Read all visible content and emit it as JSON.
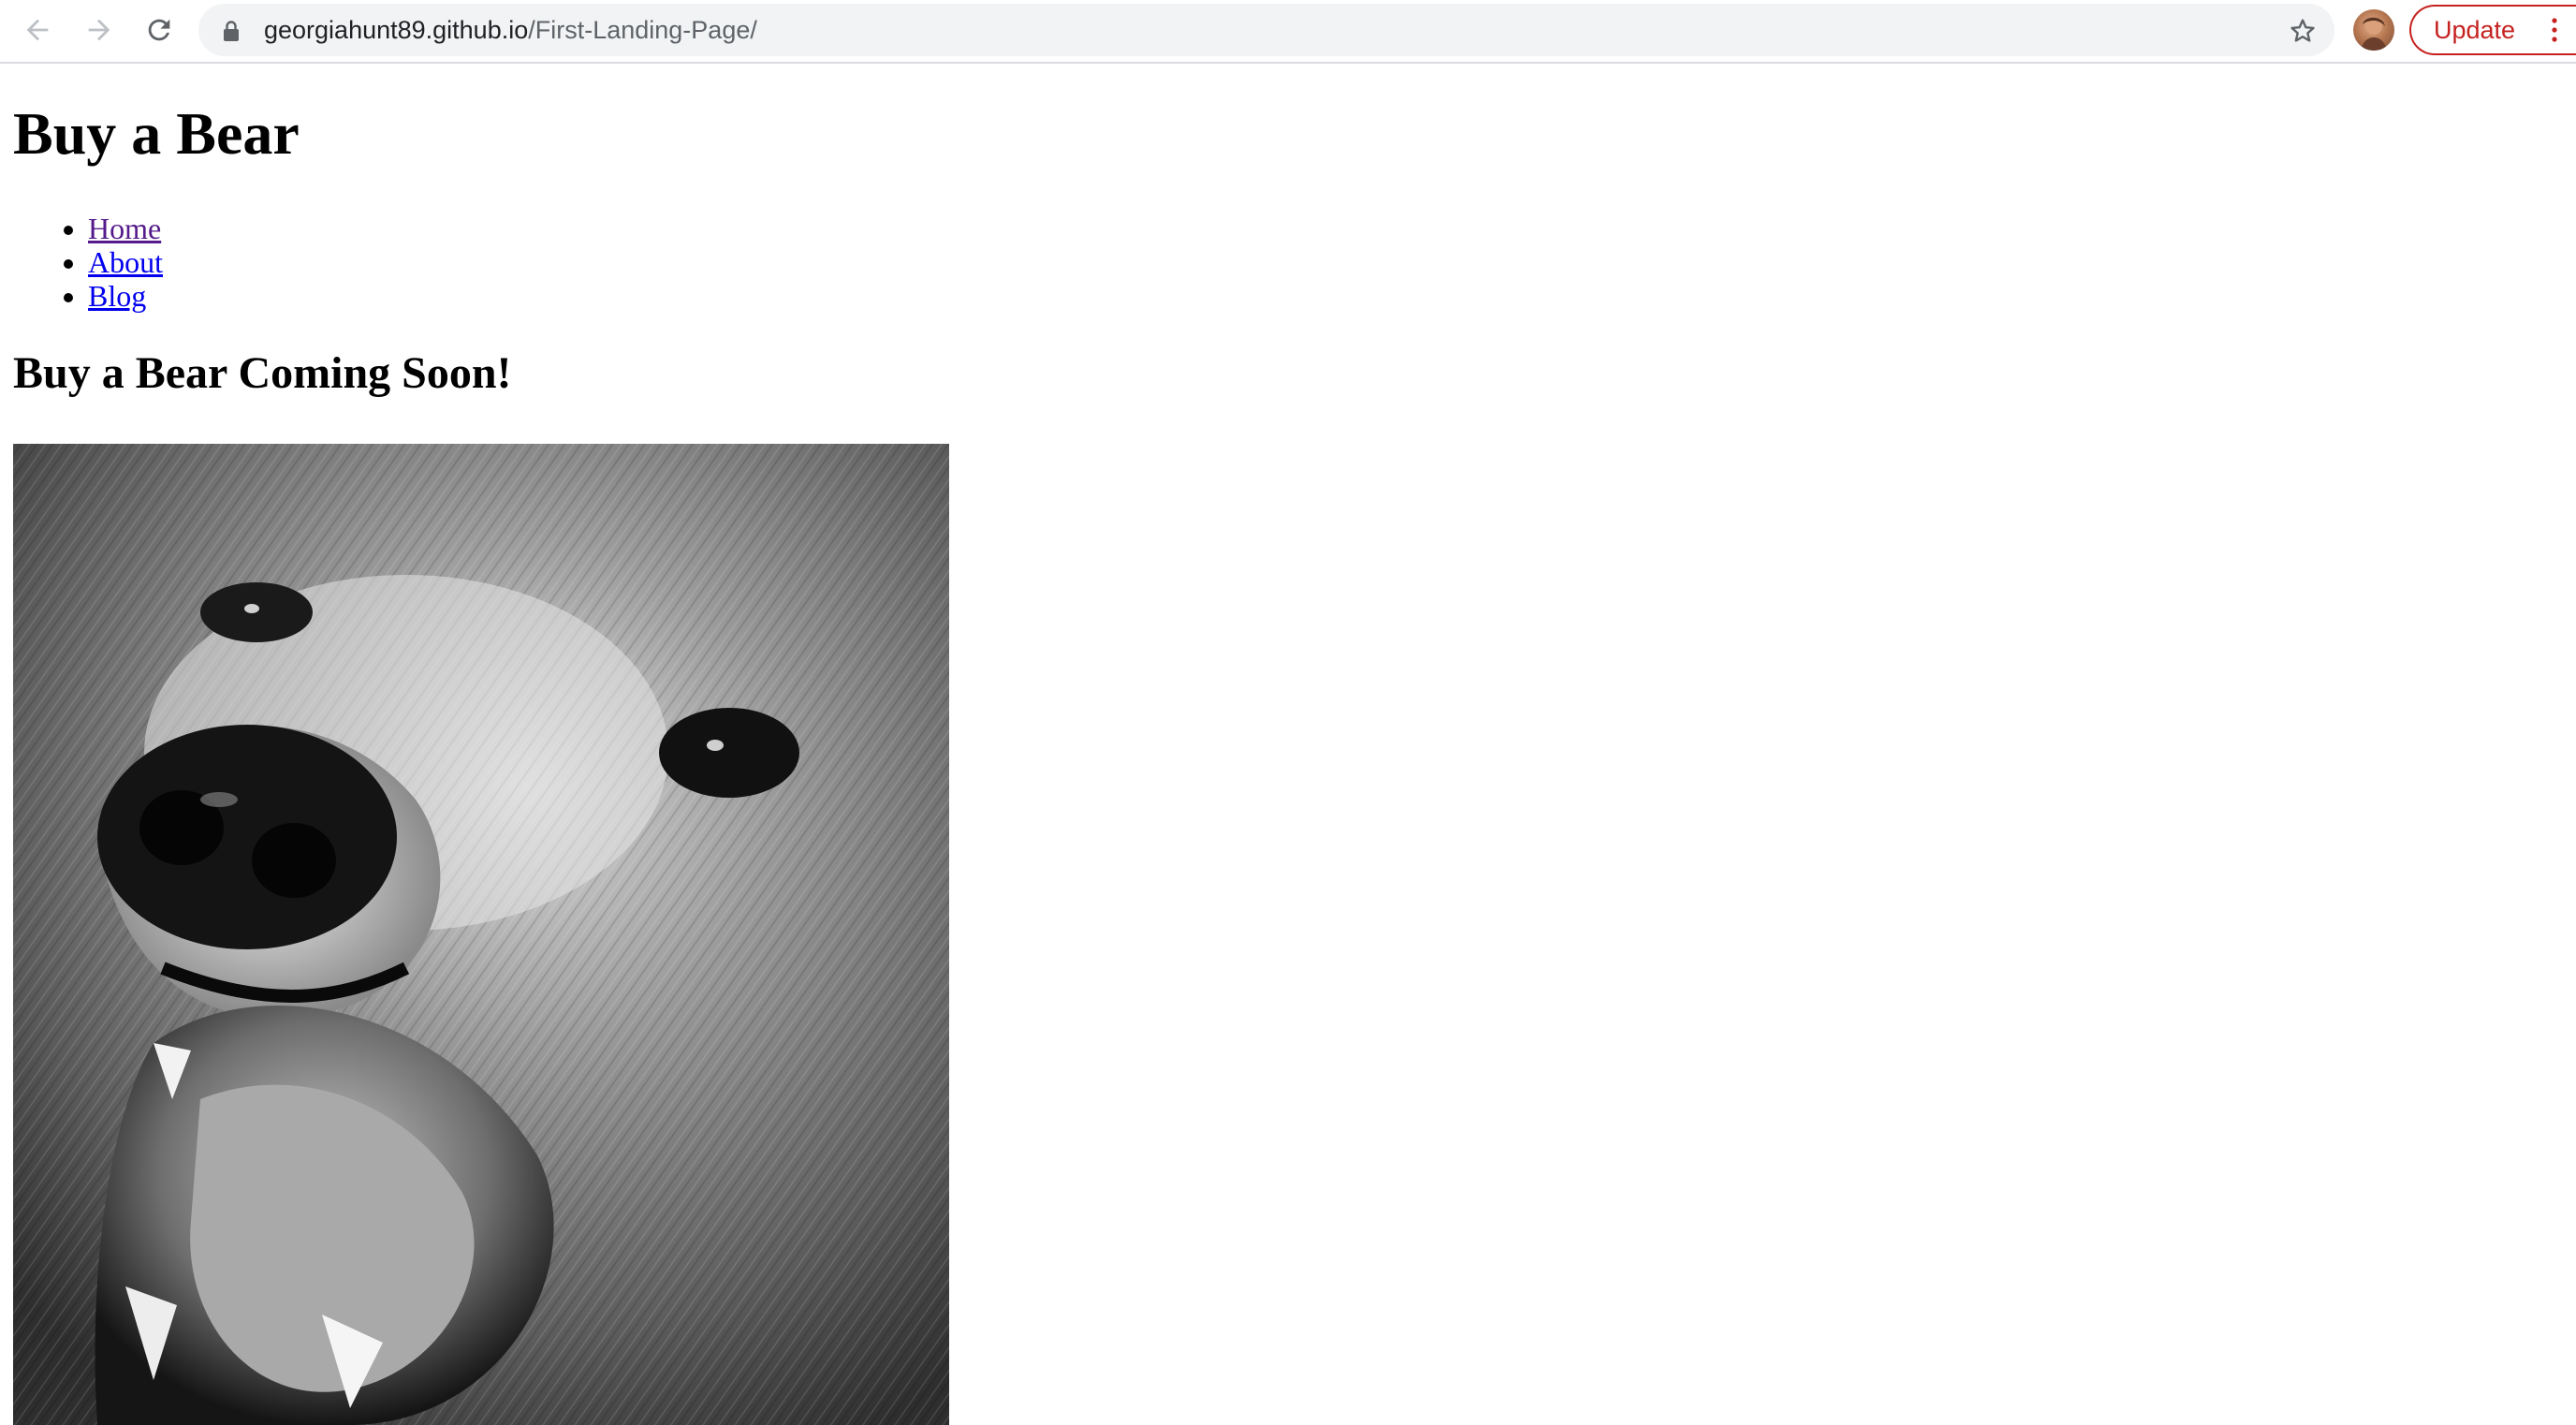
{
  "browser": {
    "url_host": "georgiahunt89.github.io",
    "url_path": "/First-Landing-Page/",
    "update_label": "Update",
    "icons": {
      "back": "arrow-left-icon",
      "forward": "arrow-right-icon",
      "reload": "reload-icon",
      "secure": "lock-icon",
      "bookmark": "star-icon",
      "menu": "kebab-menu-icon"
    },
    "colors": {
      "update_accent": "#c5221f",
      "omnibox_bg": "#f1f3f4"
    }
  },
  "page": {
    "title": "Buy a Bear",
    "nav": [
      {
        "label": "Home"
      },
      {
        "label": "About"
      },
      {
        "label": "Blog"
      }
    ],
    "subtitle": "Buy a Bear Coming Soon!",
    "image": {
      "icon": "bear-photo",
      "style": "grayscale"
    }
  }
}
